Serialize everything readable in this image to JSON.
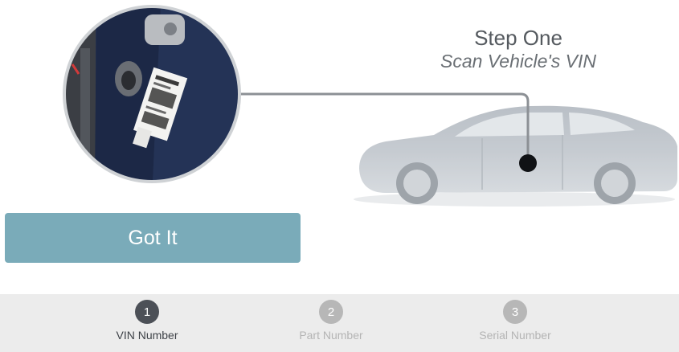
{
  "heading": {
    "title": "Step One",
    "subtitle": "Scan Vehicle's VIN"
  },
  "button": {
    "got_it_label": "Got It"
  },
  "steps": [
    {
      "number": "1",
      "label": "VIN Number",
      "active": true
    },
    {
      "number": "2",
      "label": "Part Number",
      "active": false
    },
    {
      "number": "3",
      "label": "Serial Number",
      "active": false
    }
  ],
  "colors": {
    "button": "#7aabb9",
    "active_step": "#4c5057",
    "inactive_step": "#b7b7b7",
    "stepper_bar": "#ececec",
    "door_panel": "#1f2d4a"
  },
  "icons": {
    "illustration": "vehicle-door-vin-sticker-and-car"
  }
}
